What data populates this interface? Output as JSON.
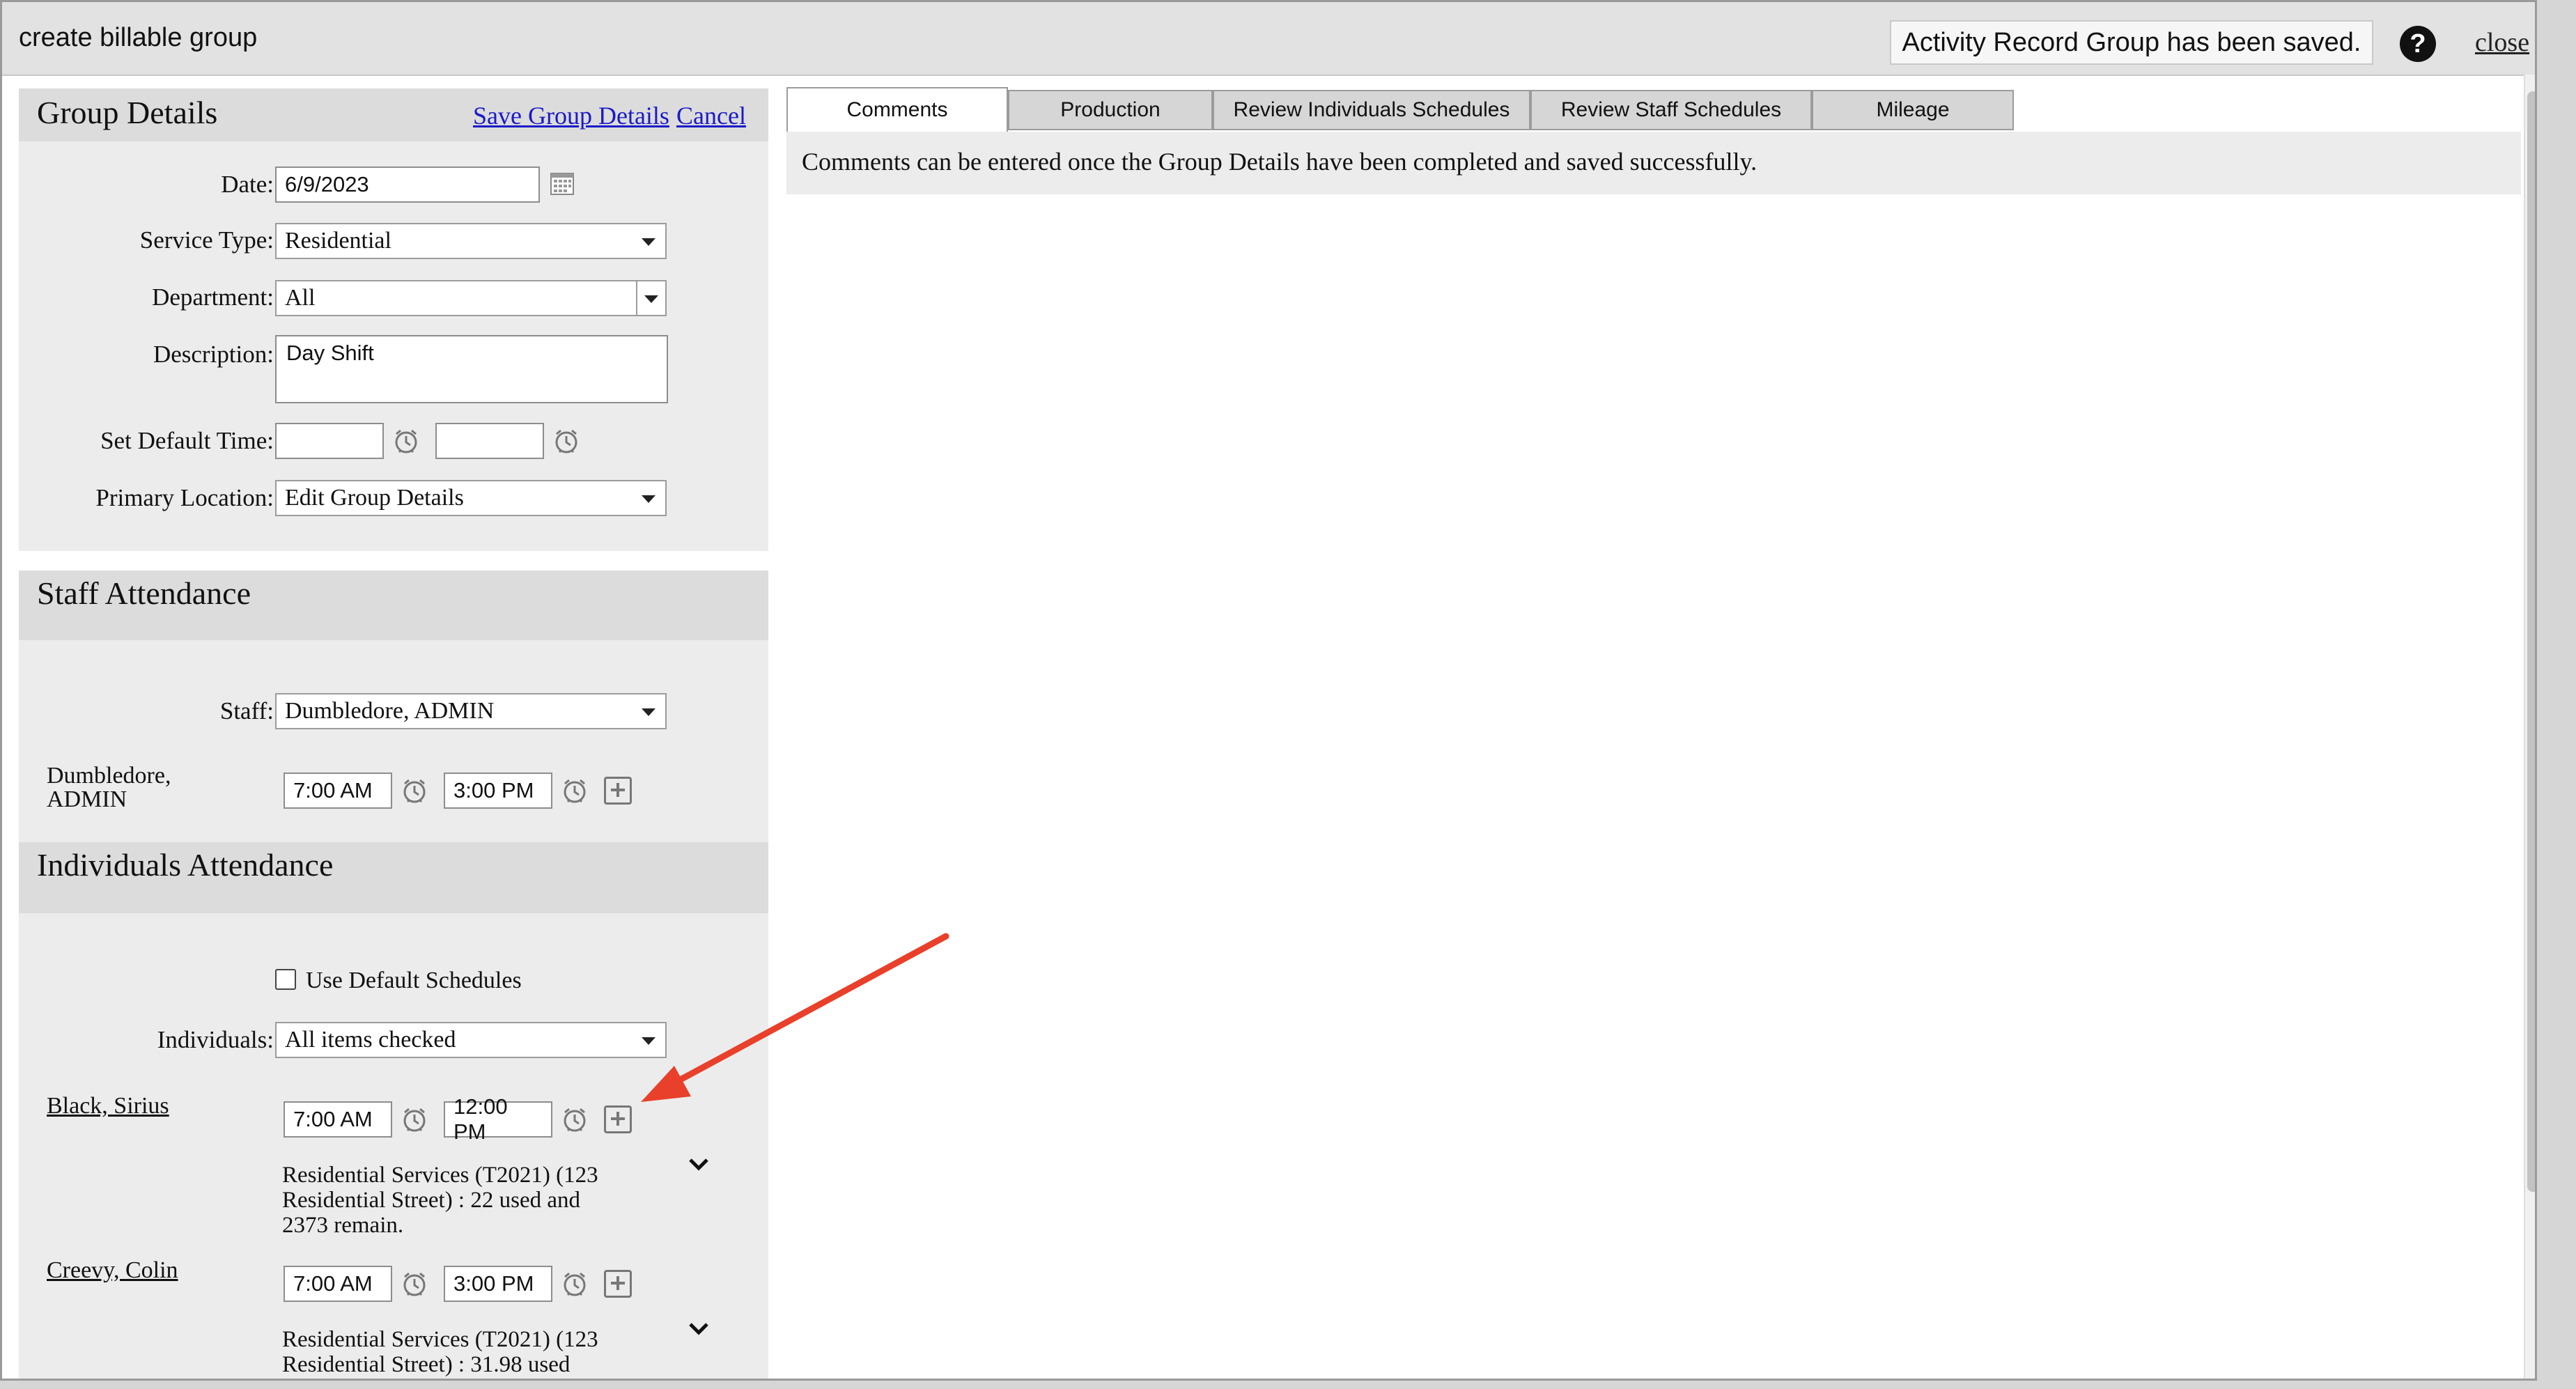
{
  "dialog": {
    "title": "create billable group",
    "saved_message": "Activity Record Group has been saved.",
    "help_symbol": "?",
    "close_label": "close"
  },
  "group_details": {
    "heading": "Group Details",
    "save_link": "Save Group Details",
    "cancel_link": "Cancel",
    "date_label": "Date:",
    "date_value": "6/9/2023",
    "service_type_label": "Service Type:",
    "service_type_value": "Residential",
    "department_label": "Department:",
    "department_value": "All",
    "description_label": "Description:",
    "description_value": "Day Shift",
    "default_time_label": "Set Default Time:",
    "default_time_start": "",
    "default_time_end": "",
    "primary_location_label": "Primary Location:",
    "primary_location_value": "Edit Group Details"
  },
  "staff_attendance": {
    "heading": "Staff Attendance",
    "staff_label": "Staff:",
    "staff_value": "Dumbledore, ADMIN",
    "rows": [
      {
        "name_line1": "Dumbledore,",
        "name_line2": "ADMIN",
        "start": "7:00 AM",
        "end": "3:00 PM"
      }
    ]
  },
  "individuals_attendance": {
    "heading": "Individuals Attendance",
    "use_default_label": "Use Default Schedules",
    "use_default_checked": false,
    "individuals_label": "Individuals:",
    "individuals_value": "All items checked",
    "rows": [
      {
        "name": "Black, Sirius",
        "start": "7:00 AM",
        "end": "12:00 PM",
        "service_line1": "Residential Services (T2021) (123",
        "service_line2": "Residential Street) : 22 used and",
        "service_line3": "2373 remain."
      },
      {
        "name": "Creevy, Colin",
        "start": "7:00 AM",
        "end": "3:00 PM",
        "service_line1": "Residential Services (T2021) (123",
        "service_line2": "Residential Street) : 31.98 used",
        "service_line3": ""
      }
    ]
  },
  "tabs": [
    {
      "label": "Comments",
      "active": true
    },
    {
      "label": "Production",
      "active": false
    },
    {
      "label": "Review Individuals Schedules",
      "active": false
    },
    {
      "label": "Review Staff Schedules",
      "active": false
    },
    {
      "label": "Mileage",
      "active": false
    }
  ],
  "comments_message": "Comments can be entered once the Group Details have been completed and saved successfully.",
  "colors": {
    "link": "#1a1ac8",
    "annotation_arrow": "#e8402a",
    "panel_bg": "#ececec",
    "panel_header_bg": "#dcdcdc"
  }
}
